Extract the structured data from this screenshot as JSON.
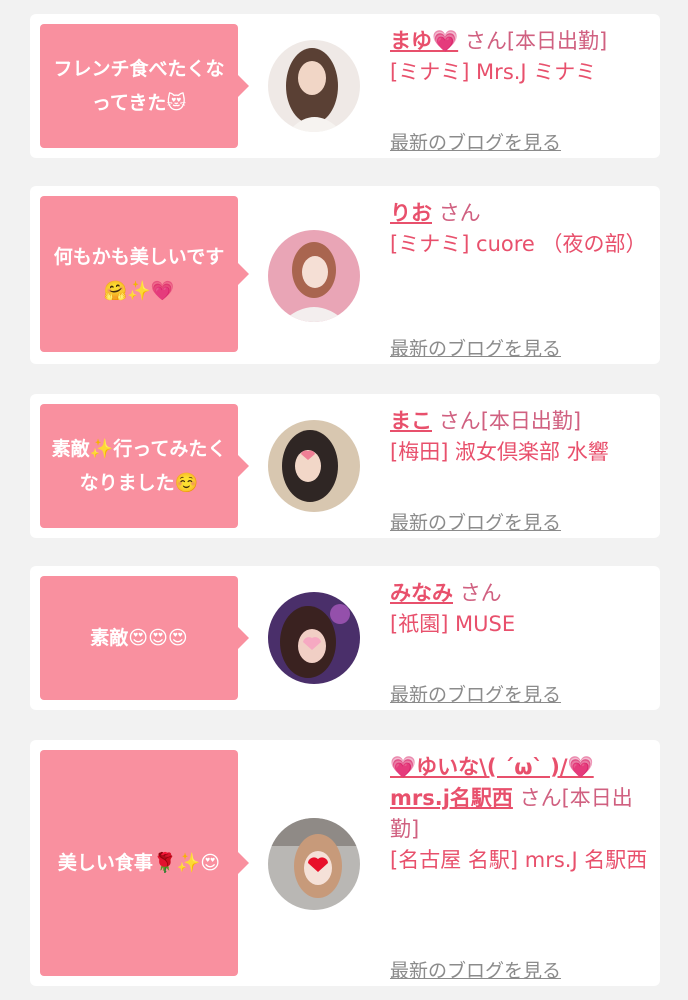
{
  "cards": [
    {
      "comment": "フレンチ食べたくなってきた",
      "comment_emoji": "😻",
      "name": "まゆ💗",
      "honorific": "さん",
      "status": "[本日出勤]",
      "shop": "[ミナミ] Mrs.J ミナミ",
      "blog_link": "最新のブログを見る"
    },
    {
      "comment": "何もかも美しいです",
      "comment_emoji": "🤗✨💗",
      "name": "りお",
      "honorific": "さん",
      "status": "",
      "shop": "[ミナミ] cuore （夜の部）",
      "blog_link": "最新のブログを見る"
    },
    {
      "comment": "素敵✨行ってみたくなりました",
      "comment_emoji": "☺️",
      "name": "まこ",
      "honorific": "さん",
      "status": "[本日出勤]",
      "shop": "[梅田] 淑女倶楽部 水響",
      "blog_link": "最新のブログを見る"
    },
    {
      "comment": "素敵",
      "comment_emoji": "😍😍😍",
      "name": "みなみ",
      "honorific": "さん",
      "status": "",
      "shop": "[祇園] MUSE",
      "blog_link": "最新のブログを見る"
    },
    {
      "comment": "美しい食事",
      "comment_emoji": "🌹✨😍",
      "name": "💗ゆいな\\( ´ω` )/💗mrs.j名駅西",
      "honorific": "さん",
      "status": "[本日出勤]",
      "shop": "[名古屋 名駅] mrs.J 名駅西",
      "blog_link": "最新のブログを見る"
    }
  ],
  "colors": {
    "bubble": "#f9909f",
    "name": "#e8506c",
    "link": "#8b8b8b",
    "background": "#f2f2f2"
  }
}
